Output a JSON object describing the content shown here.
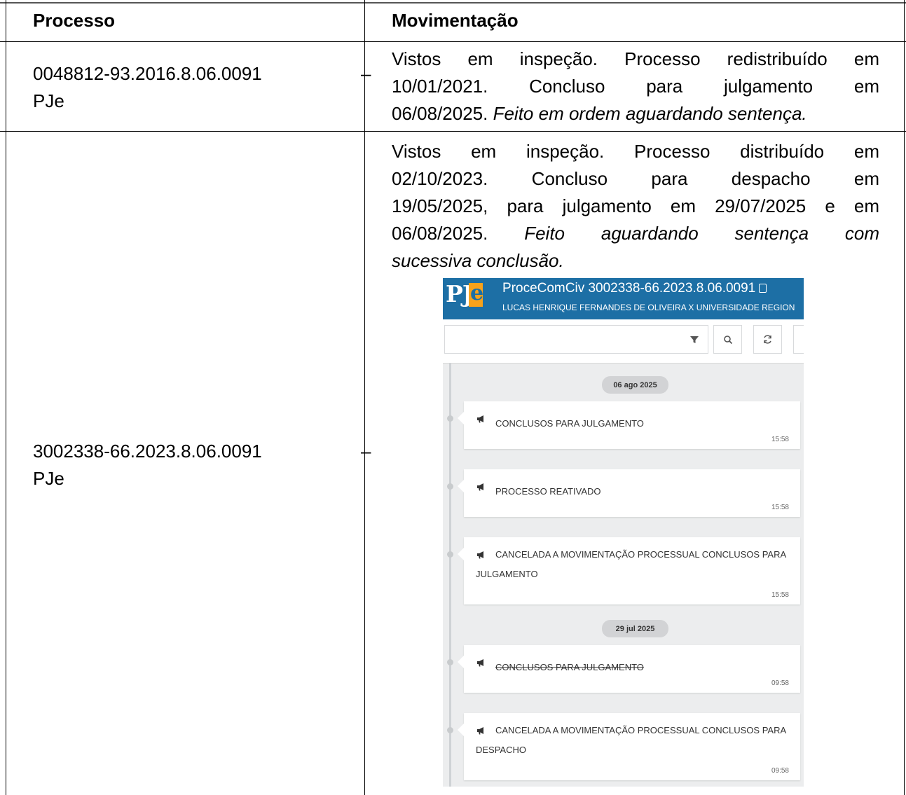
{
  "table": {
    "headers": {
      "process": "Processo",
      "movement": "Movimentação"
    },
    "rows": [
      {
        "process_number": "0048812-93.2016.8.06.0091",
        "dash": "–",
        "system": "PJe",
        "movement_lines": [
          "Vistos em inspeção. Processo redistribuído em",
          "10/01/2021. Concluso para julgamento em"
        ],
        "movement_last_plain": "06/08/2025. ",
        "movement_last_italic": "Feito em ordem aguardando sentença."
      },
      {
        "process_number": "3002338-66.2023.8.06.0091",
        "dash": "–",
        "system": "PJe",
        "movement_lines": [
          "Vistos em inspeção. Processo distribuído em",
          "02/10/2023. Concluso para despacho em",
          "19/05/2025, para julgamento em 29/07/2025 e em"
        ],
        "movement_line4_plain": "06/08/2025. ",
        "movement_line4_italic": "Feito aguardando sentença com",
        "movement_line5_italic": "sucessiva conclusão."
      }
    ]
  },
  "pje_screenshot": {
    "logo_text": "PJ",
    "logo_accent": "e",
    "title": "ProceComCiv 3002338-66.2023.8.06.0091",
    "subtitle": "LUCAS HENRIQUE FERNANDES DE OLIVEIRA X UNIVERSIDADE REGION",
    "toolbar_icons": [
      "filter-icon",
      "search-icon",
      "refresh-icon",
      "chevron-left-icon"
    ],
    "groups": [
      {
        "date": "06 ago 2025",
        "events": [
          {
            "text": "CONCLUSOS PARA JULGAMENTO",
            "time": "15:58",
            "struck": false
          },
          {
            "text": "PROCESSO REATIVADO",
            "time": "15:58",
            "struck": false
          },
          {
            "text": "CANCELADA A MOVIMENTAÇÃO PROCESSUAL CONCLUSOS PARA JULGAMENTO",
            "time": "15:58",
            "struck": false
          }
        ]
      },
      {
        "date": "29 jul 2025",
        "events": [
          {
            "text": "CONCLUSOS PARA JULGAMENTO",
            "time": "09:58",
            "struck": true
          },
          {
            "text": "CANCELADA A MOVIMENTAÇÃO PROCESSUAL CONCLUSOS PARA DESPACHO",
            "time": "09:58",
            "struck": false
          }
        ]
      }
    ],
    "colors": {
      "header_blue": "#1d6fa5",
      "logo_orange": "#f7a21b",
      "timeline_bg": "#ecedee"
    }
  }
}
